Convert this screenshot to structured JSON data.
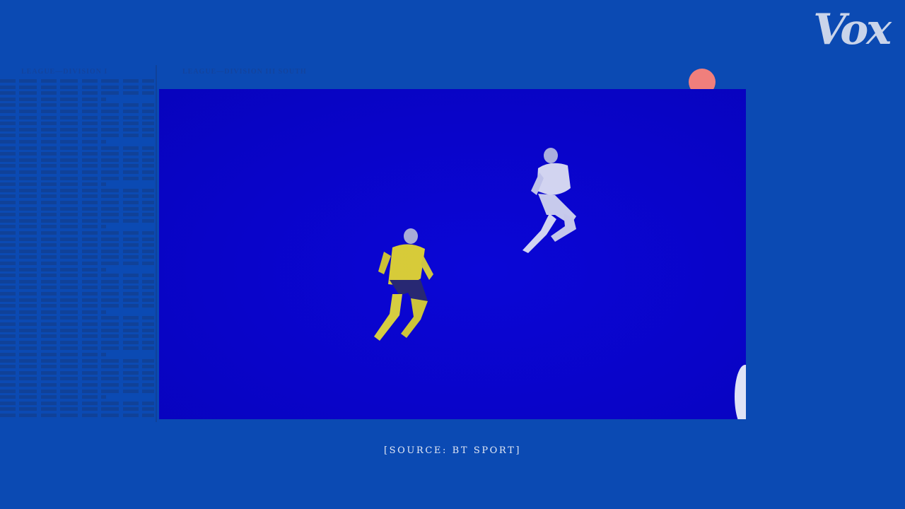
{
  "brand": {
    "logo_text": "Vox"
  },
  "background": {
    "newsprint_headings": [
      "LEAGUE—DIVISION I",
      "LEAGUE—DIVISION III SOUTH"
    ]
  },
  "video": {
    "subject": "two animated footballers on blue field"
  },
  "caption": {
    "text": "[SOURCE: BT SPORT]"
  },
  "colors": {
    "background": "#0b4ab3",
    "video_field": "#0904c8",
    "record_dot": "#f07f7c",
    "caption": "#e4e9f5",
    "player_yellow": "#e2d631",
    "player_white": "#e4e6f4"
  }
}
